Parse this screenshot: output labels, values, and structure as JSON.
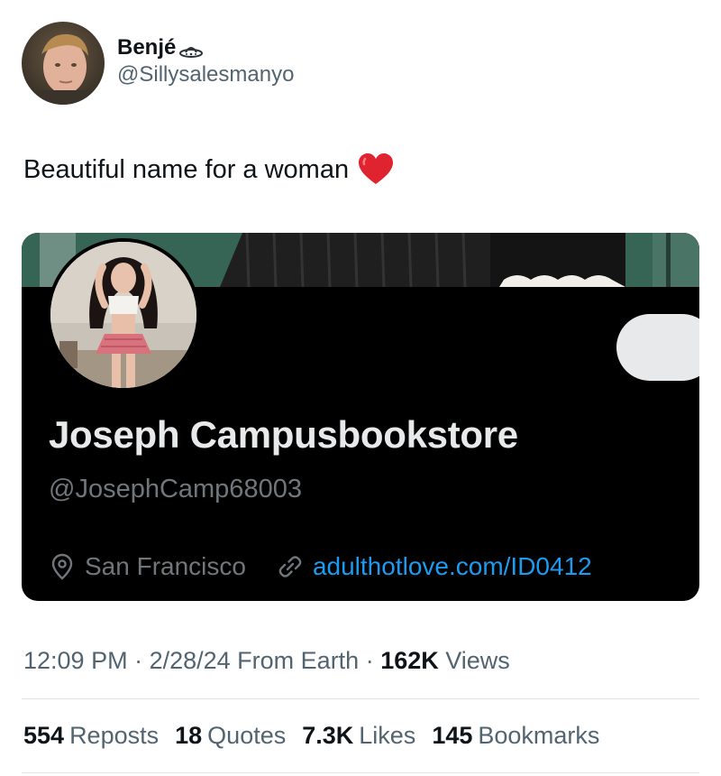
{
  "author": {
    "display_name": "Benjé",
    "handle": "@Sillysalesmanyo",
    "avatar_icon": "user-avatar-photo",
    "badge_icon": "ufo-icon"
  },
  "tweet": {
    "text": "Beautiful name for a woman",
    "emoji_icon": "red-heart-icon"
  },
  "embedded_profile": {
    "name": "Joseph Campusbookstore",
    "handle": "@JosephCamp68003",
    "location": "San Francisco",
    "location_icon": "location-pin-icon",
    "link": "adulthotlove.com/ID0412",
    "link_icon": "link-icon",
    "link_color": "#1d9bf0"
  },
  "meta": {
    "time": "12:09 PM",
    "sep1": " · ",
    "date": "2/28/24",
    "source": " From Earth",
    "sep2": " · ",
    "views_count": "162K",
    "views_label": " Views"
  },
  "stats": [
    {
      "count": "554",
      "label": "Reposts"
    },
    {
      "count": "18",
      "label": "Quotes"
    },
    {
      "count": "7.3K",
      "label": "Likes"
    },
    {
      "count": "145",
      "label": "Bookmarks"
    }
  ]
}
